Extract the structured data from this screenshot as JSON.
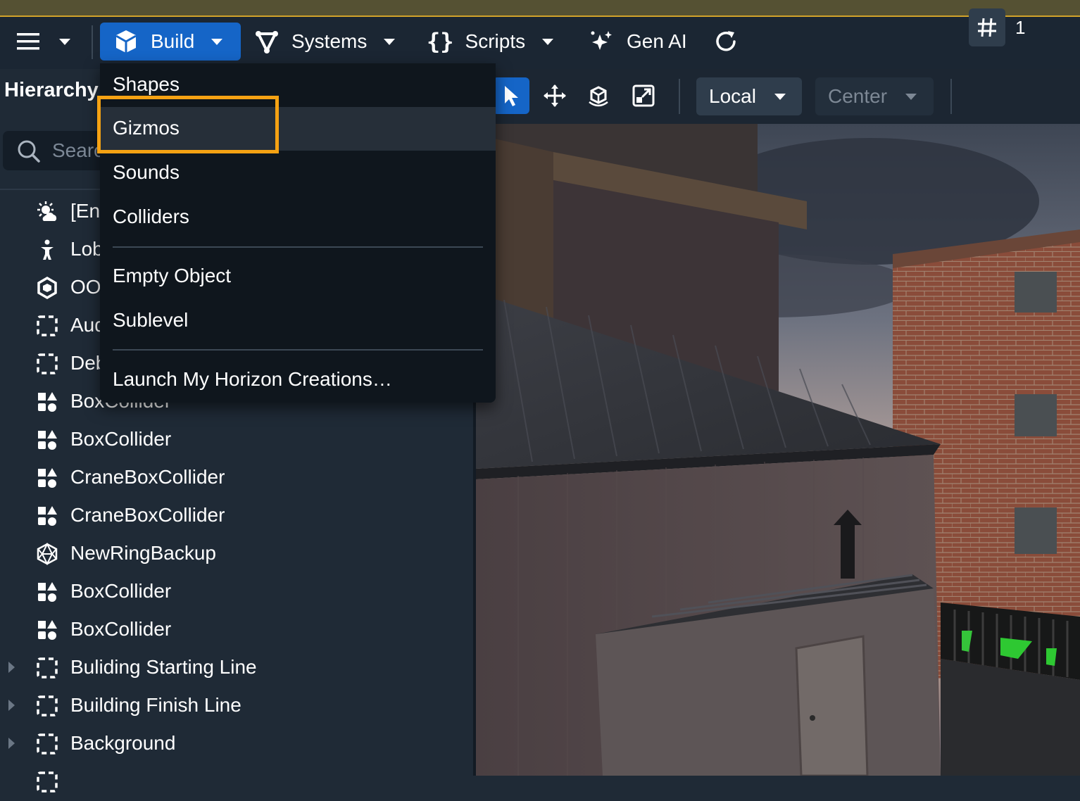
{
  "menubar": {
    "build_label": "Build",
    "systems_label": "Systems",
    "scripts_label": "Scripts",
    "genai_label": "Gen AI"
  },
  "hierarchy": {
    "title": "Hierarchy",
    "search_placeholder": "Search",
    "items": [
      {
        "label": "[Environment]",
        "icon": "sun-cloud-icon"
      },
      {
        "label": "Lobby",
        "icon": "spawn-point-icon"
      },
      {
        "label": "OOB",
        "icon": "hex-gizmo-icon"
      },
      {
        "label": "Audio",
        "icon": "empty-object-icon"
      },
      {
        "label": "Debug",
        "icon": "empty-object-icon"
      },
      {
        "label": "BoxCollider",
        "icon": "shapes-icon"
      },
      {
        "label": "BoxCollider",
        "icon": "shapes-icon"
      },
      {
        "label": "CraneBoxCollider",
        "icon": "shapes-icon"
      },
      {
        "label": "CraneBoxCollider",
        "icon": "shapes-icon"
      },
      {
        "label": "NewRingBackup",
        "icon": "polyhedron-icon"
      },
      {
        "label": "BoxCollider",
        "icon": "shapes-icon"
      },
      {
        "label": "BoxCollider",
        "icon": "shapes-icon"
      },
      {
        "label": "Buliding Starting Line",
        "icon": "empty-object-icon"
      },
      {
        "label": "Building Finish Line",
        "icon": "empty-object-icon"
      },
      {
        "label": "Background",
        "icon": "empty-object-icon"
      }
    ]
  },
  "toolbar": {
    "space_value": "Local",
    "pivot_value": "Center",
    "grid_value": "1"
  },
  "build_menu": {
    "items": [
      "Shapes",
      "Gizmos",
      "Sounds",
      "Colliders",
      "Empty Object",
      "Sublevel",
      "Launch My Horizon Creations…"
    ],
    "highlighted": "Gizmos"
  },
  "colors": {
    "accent": "#1565c7",
    "highlight_box": "#f5a213",
    "panel_bg": "#1f2a36"
  }
}
